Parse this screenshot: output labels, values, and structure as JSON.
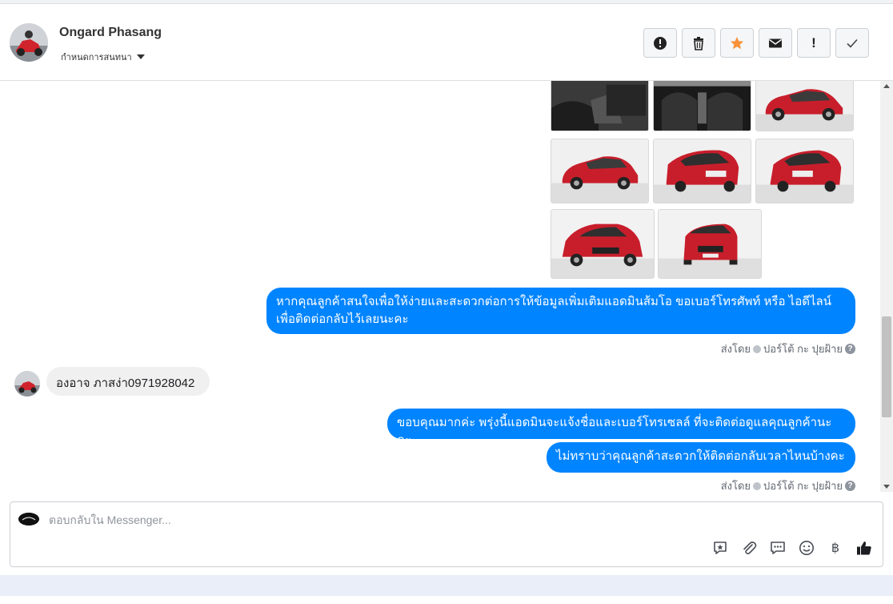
{
  "header": {
    "contact_name": "Ongard Phasang",
    "assign_label": "กำหนดการสนทนา"
  },
  "actions": [
    {
      "name": "report-spam-button",
      "icon": "exclamation-circle-icon"
    },
    {
      "name": "delete-button",
      "icon": "trash-icon"
    },
    {
      "name": "star-button",
      "icon": "star-icon"
    },
    {
      "name": "mark-unread-button",
      "icon": "envelope-icon"
    },
    {
      "name": "follow-up-button",
      "label": "!"
    },
    {
      "name": "mark-done-button",
      "icon": "checkmark-icon"
    }
  ],
  "messages": {
    "out1": "หากคุณลูกค้าสนใจเพื่อให้ง่ายและสะดวกต่อการให้ข้อมูลเพิ่มเติมแอดมินส้มโอ ขอเบอร์โทรศัพท์ หรือ ไอดีไลน์ เพื่อติดต่อกลับไว้เลยนะคะ",
    "in1": "องอาจ ภาสง่า0971928042",
    "out2": "ขอบคุณมากค่ะ พรุ่งนี้แอดมินจะแจ้งชื่อและเบอร์โทรเซลล์ ที่จะติดต่อดูแลคุณลูกค้านะคะ",
    "out3": "ไม่ทราบว่าคุณลูกค้าสะดวกให้ติดต่อกลับเวลาไหนบ้างคะ"
  },
  "sent_by": {
    "prefix": "ส่งโดย",
    "agent": "ปอร์โต้ กะ ปุยฝ้าย",
    "help": "?"
  },
  "composer": {
    "placeholder": "ตอบกลับใน Messenger...",
    "baht_symbol": "฿"
  },
  "colors": {
    "outgoing_bubble": "#0084ff",
    "incoming_bubble": "#f0f0f0",
    "star": "#f7923a"
  }
}
